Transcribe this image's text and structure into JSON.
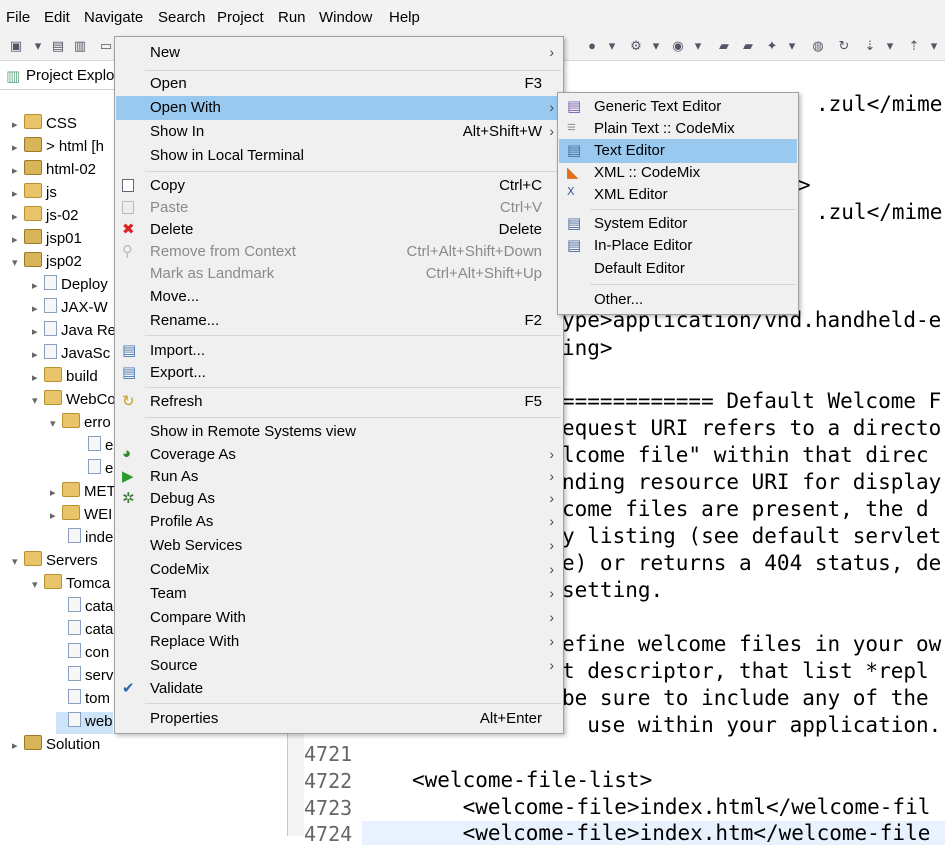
{
  "menubar": {
    "items": [
      "File",
      "Edit",
      "Navigate",
      "Search",
      "Project",
      "Run",
      "Window",
      "Help"
    ]
  },
  "explorer": {
    "title": "Project Explo",
    "tree": [
      {
        "label": "CSS"
      },
      {
        "label": "> html [h"
      },
      {
        "label": "html-02"
      },
      {
        "label": "js"
      },
      {
        "label": "js-02"
      },
      {
        "label": "jsp01"
      },
      {
        "label": "jsp02"
      },
      {
        "label": "Deploy"
      },
      {
        "label": "JAX-W"
      },
      {
        "label": "Java Re"
      },
      {
        "label": "JavaSc"
      },
      {
        "label": "build"
      },
      {
        "label": "WebCo"
      },
      {
        "label": "erro"
      },
      {
        "label": "e"
      },
      {
        "label": "e"
      },
      {
        "label": "MET"
      },
      {
        "label": "WEI"
      },
      {
        "label": "inde"
      },
      {
        "label": "Servers"
      },
      {
        "label": "Tomca"
      },
      {
        "label": "cata"
      },
      {
        "label": "cata"
      },
      {
        "label": "con"
      },
      {
        "label": "serv"
      },
      {
        "label": "tom"
      },
      {
        "label": "web"
      },
      {
        "label": "Solution"
      }
    ]
  },
  "editor": {
    "lines": [
      ".zul</mime-",
      ">",
      ".zul</mime-",
      "ype>application/vnd.handheld-e",
      "ing>",
      "============ Default Welcome F",
      "equest URI refers to a directo",
      "lcome file\" within that direc",
      "nding resource URI for display",
      "come files are present, the d",
      "y listing (see default servlet",
      "e) or returns a 404 status, de",
      "setting.",
      "efine welcome files in your ow",
      "t descriptor, that list *repl",
      "be sure to include any of the",
      "  use within your application."
    ],
    "bottom_lines": [
      {
        "num": "4721",
        "text": ""
      },
      {
        "num": "4722",
        "text": "<welcome-file-list>"
      },
      {
        "num": "4723",
        "text": "    <welcome-file>index.html</welcome-fil"
      },
      {
        "num": "4724",
        "text": "    <welcome-file>index.htm</welcome-file"
      }
    ]
  },
  "context_menu": {
    "new": "New",
    "open": "Open",
    "open_sc": "F3",
    "open_with": "Open With",
    "show_in": "Show In",
    "show_in_sc": "Alt+Shift+W",
    "show_terminal": "Show in Local Terminal",
    "copy": "Copy",
    "copy_sc": "Ctrl+C",
    "paste": "Paste",
    "paste_sc": "Ctrl+V",
    "delete": "Delete",
    "delete_sc": "Delete",
    "remove_context": "Remove from Context",
    "remove_context_sc": "Ctrl+Alt+Shift+Down",
    "mark_landmark": "Mark as Landmark",
    "mark_landmark_sc": "Ctrl+Alt+Shift+Up",
    "move": "Move...",
    "rename": "Rename...",
    "rename_sc": "F2",
    "import": "Import...",
    "export": "Export...",
    "refresh": "Refresh",
    "refresh_sc": "F5",
    "show_remote": "Show in Remote Systems view",
    "coverage": "Coverage As",
    "run_as": "Run As",
    "debug_as": "Debug As",
    "profile_as": "Profile As",
    "web_services": "Web Services",
    "codemix": "CodeMix",
    "team": "Team",
    "compare_with": "Compare With",
    "replace_with": "Replace With",
    "source": "Source",
    "validate": "Validate",
    "properties": "Properties",
    "properties_sc": "Alt+Enter"
  },
  "submenu": {
    "generic_text": "Generic Text Editor",
    "plain_text": "Plain Text :: CodeMix",
    "text_editor": "Text Editor",
    "xml_codemix": "XML :: CodeMix",
    "xml_editor": "XML Editor",
    "system_editor": "System Editor",
    "inplace_editor": "In-Place Editor",
    "default_editor": "Default Editor",
    "other": "Other..."
  },
  "colors": {
    "highlight": "#99c9ef",
    "menu_bg": "#f0f0f0"
  }
}
